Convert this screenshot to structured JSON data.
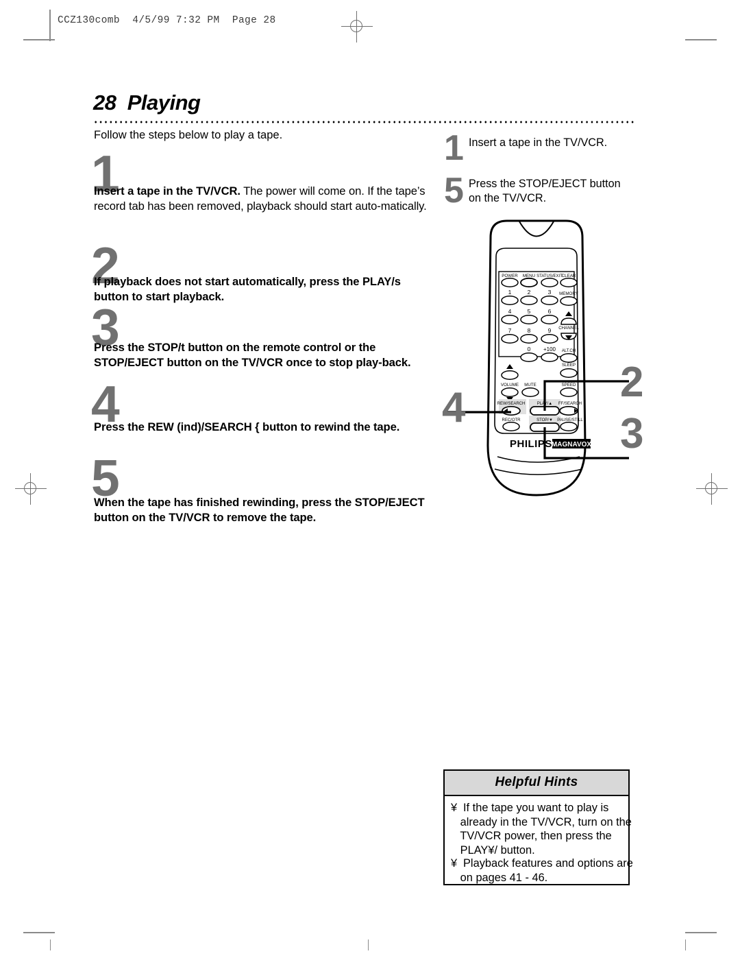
{
  "slug": {
    "text": "CCZ130comb  4/5/99 7:32 PM  Page 28"
  },
  "title": "28  Playing",
  "intro": "Follow the steps below to play a tape.",
  "left_steps": [
    {
      "number": "1",
      "bold": "Insert a tape in the TV/VCR.",
      "regular": " The power will come on. If the tape’s record tab has been removed, playback should start auto-matically."
    },
    {
      "number": "2",
      "bold": "If playback does not start automatically, press the PLAY/s  button to start playback.",
      "regular": ""
    },
    {
      "number": "3",
      "bold": "Press the STOP/t  button on the remote control or the STOP/EJECT button on the TV/VCR once to stop play-back.",
      "regular": ""
    },
    {
      "number": "4",
      "bold": "Press the REW (ind)/SEARCH {  button to rewind the tape.",
      "regular": ""
    },
    {
      "number": "5",
      "bold": "When the tape has finished rewinding, press the STOP/EJECT button on the TV/VCR to remove the tape.",
      "regular": ""
    }
  ],
  "right_callouts": [
    {
      "number": "1",
      "text": "Insert a tape in the TV/VCR."
    },
    {
      "number": "5",
      "text": "Press the STOP/EJECT button\non the TV/VCR."
    }
  ],
  "diagram_callouts": [
    {
      "number": "2",
      "target": "play-button"
    },
    {
      "number": "3",
      "target": "stop-button"
    },
    {
      "number": "4",
      "target": "rew-search-button"
    }
  ],
  "remote": {
    "brand_primary": "PHILIPS",
    "brand_secondary": "MAGNAVOX",
    "row_top": [
      "POWER",
      "MENU",
      "STATUS/EXIT",
      "CLEAR"
    ],
    "keypad": [
      [
        "1",
        "2",
        "3",
        "MEMORY"
      ],
      [
        "4",
        "5",
        "6",
        ""
      ],
      [
        "7",
        "8",
        "9",
        "CHANNEL"
      ],
      [
        "0",
        "+100",
        "ALT.CH",
        ""
      ]
    ],
    "channel_label": "CHANNEL",
    "memory_label": "MEMORY",
    "altch_label": "ALT.CH",
    "volume_label": "VOLUME",
    "mute_label": "MUTE",
    "sleep_label": "SLEEP",
    "speed_label": "SPEED",
    "rew_label": "REW/SEARCH",
    "play_label": "PLAY/▲",
    "ff_label": "FF/SEARCH",
    "rec_label": "REC/OTR",
    "stop_label": "STOP/▼",
    "pause_label": "PAUSE/STILL"
  },
  "hints": {
    "header": "Helpful Hints",
    "bullet": "¥",
    "items": [
      "If the tape you want to play is\n   already in the TV/VCR, turn on the\n   TV/VCR power, then press the\n   PLAY¥/ button.",
      "Playback features and options are\n   on pages 41 - 46."
    ]
  },
  "colors": {
    "step_number_gray": "#717171",
    "hint_header_fill": "#d8d8d8",
    "button_highlight": "#e0e0e0"
  }
}
